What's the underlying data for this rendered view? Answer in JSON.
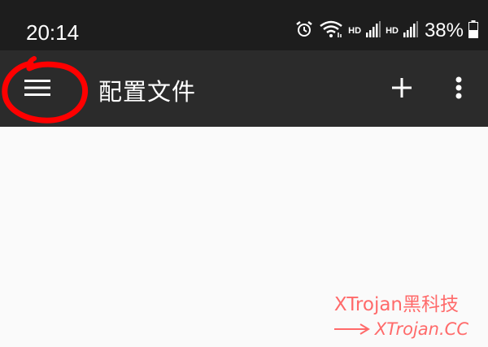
{
  "status_bar": {
    "time": "20:14",
    "hd_label_1": "HD",
    "hd_label_2": "HD",
    "battery_percent": "38%",
    "icons": [
      "alarm-icon",
      "wifi-icon",
      "signal-icon",
      "signal-icon",
      "battery-icon"
    ]
  },
  "app_bar": {
    "title": "配置文件",
    "icons": [
      "menu-icon",
      "add-icon",
      "more-vert-icon"
    ],
    "background": "#2b2b2b"
  },
  "annotation": {
    "color": "#ff0000",
    "shape": "red hand-drawn circle around menu button"
  },
  "watermark": {
    "title": "XTrojan黑科技",
    "url": "XTrojan.CC",
    "color": "#ff6a6a"
  }
}
